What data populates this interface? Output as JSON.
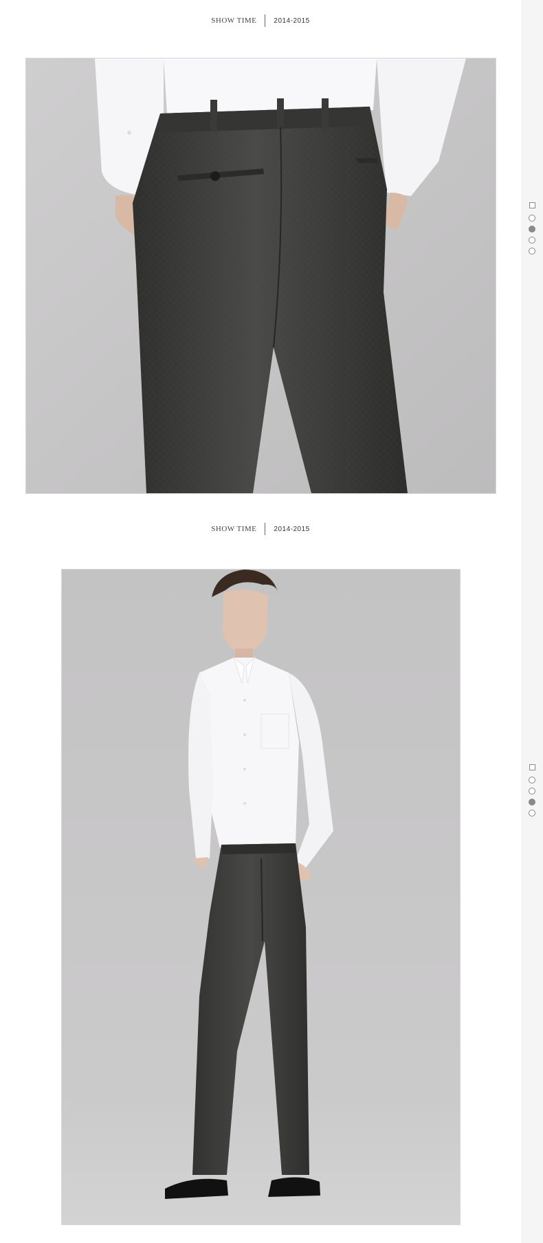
{
  "sections": [
    {
      "header": {
        "label": "SHOW TIME",
        "year": "2014-2015"
      },
      "photo": {
        "subject": "back view of charcoal dress trousers"
      },
      "nav_dots": {
        "active": 2,
        "count": 4
      }
    },
    {
      "header": {
        "label": "SHOW TIME",
        "year": "2014-2015"
      },
      "photo": {
        "subject": "model in white shirt and charcoal dress trousers"
      },
      "nav_dots": {
        "active": 3,
        "count": 4
      }
    }
  ],
  "colors": {
    "backdrop": "#c8c7c7",
    "trousers": "#3e3e3d",
    "shirt": "#f7f7f9",
    "rail": "#f5f5f5",
    "active_dot": "#8a8a8a"
  },
  "icons": [
    "square-icon",
    "circle-dot-icon"
  ]
}
